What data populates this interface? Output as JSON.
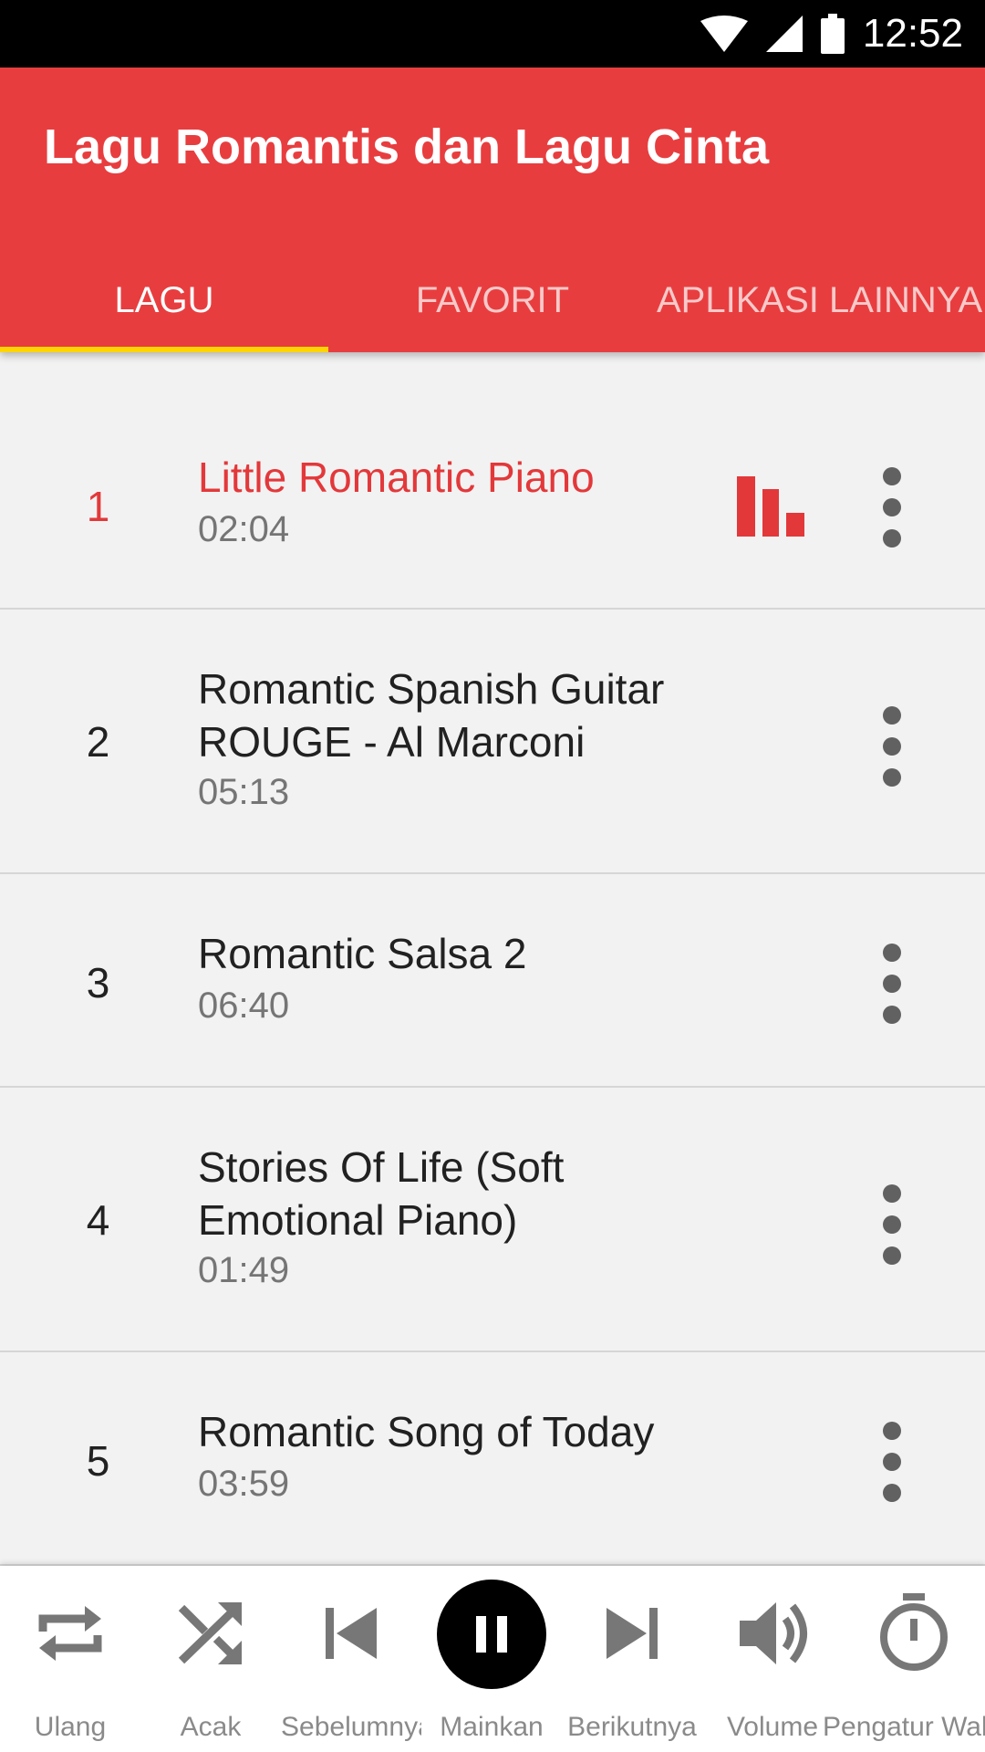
{
  "status_bar": {
    "time": "12:52",
    "icons": [
      "wifi-icon",
      "signal-icon",
      "battery-icon"
    ]
  },
  "app_bar": {
    "title": "Lagu Romantis dan Lagu Cinta",
    "color": "#e83d3f"
  },
  "tabs": [
    {
      "label": "LAGU",
      "active": true
    },
    {
      "label": "FAVORIT",
      "active": false
    },
    {
      "label": "APLIKASI LAINNYA",
      "active": false
    }
  ],
  "tab_indicator_color": "#ffd400",
  "songs": [
    {
      "number": "1",
      "title": "Little Romantic Piano",
      "duration": "02:04",
      "playing": true
    },
    {
      "number": "2",
      "title": "Romantic Spanish Guitar ROUGE - Al Marconi",
      "duration": "05:13",
      "playing": false
    },
    {
      "number": "3",
      "title": "Romantic Salsa 2",
      "duration": "06:40",
      "playing": false
    },
    {
      "number": "4",
      "title": "Stories Of Life (Soft Emotional Piano)",
      "duration": "01:49",
      "playing": false
    },
    {
      "number": "5",
      "title": "Romantic Song of Today",
      "duration": "03:59",
      "playing": false
    }
  ],
  "player_controls": [
    {
      "label": "Ulang",
      "icon": "repeat-icon"
    },
    {
      "label": "Acak",
      "icon": "shuffle-icon"
    },
    {
      "label": "Sebelumnya",
      "icon": "skip-previous-icon"
    },
    {
      "label": "Mainkan",
      "icon": "pause-icon"
    },
    {
      "label": "Berikutnya",
      "icon": "skip-next-icon"
    },
    {
      "label": "Volume",
      "icon": "volume-icon"
    },
    {
      "label": "Pengatur Waktu",
      "icon": "timer-icon"
    }
  ],
  "colors": {
    "accent": "#e3383a",
    "text": "#212121",
    "secondary_text": "#757575"
  }
}
